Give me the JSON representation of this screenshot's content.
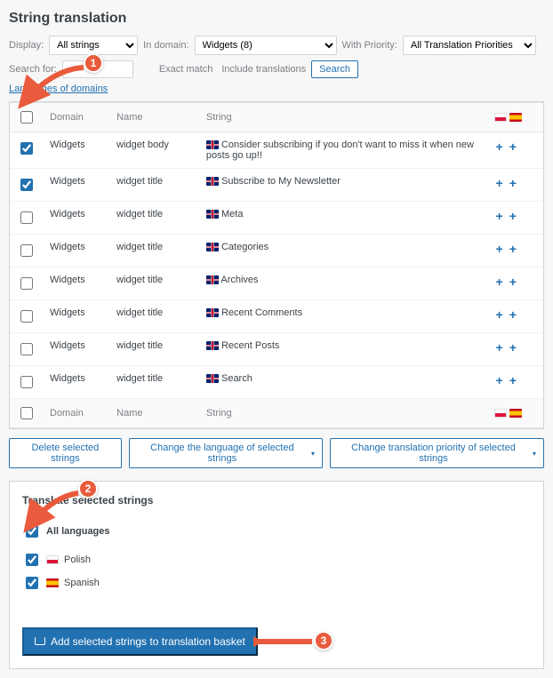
{
  "page_title": "String translation",
  "filters": {
    "display_label": "Display:",
    "display_options": [
      "All strings"
    ],
    "display_value": "All strings",
    "domain_label": "In domain:",
    "domain_options": [
      "Widgets (8)"
    ],
    "domain_value": "Widgets (8)",
    "priority_label": "With Priority:",
    "priority_options": [
      "All Translation Priorities"
    ],
    "priority_value": "All Translation Priorities",
    "search_label": "Search for:",
    "search_value": "",
    "exact_match_label": "Exact match",
    "include_translations_label": "Include translations",
    "search_button": "Search",
    "languages_link": "Languages of domains"
  },
  "table": {
    "headers": {
      "domain": "Domain",
      "name": "Name",
      "string": "String"
    },
    "header_flags": [
      "pl",
      "es"
    ],
    "rows": [
      {
        "checked": true,
        "domain": "Widgets",
        "name": "widget body",
        "flag": "gb",
        "string": "Consider subscribing if you don't want to miss it when new posts go up!!"
      },
      {
        "checked": true,
        "domain": "Widgets",
        "name": "widget title",
        "flag": "gb",
        "string": "Subscribe to My Newsletter"
      },
      {
        "checked": false,
        "domain": "Widgets",
        "name": "widget title",
        "flag": "gb",
        "string": "Meta"
      },
      {
        "checked": false,
        "domain": "Widgets",
        "name": "widget title",
        "flag": "gb",
        "string": "Categories"
      },
      {
        "checked": false,
        "domain": "Widgets",
        "name": "widget title",
        "flag": "gb",
        "string": "Archives"
      },
      {
        "checked": false,
        "domain": "Widgets",
        "name": "widget title",
        "flag": "gb",
        "string": "Recent Comments"
      },
      {
        "checked": false,
        "domain": "Widgets",
        "name": "widget title",
        "flag": "gb",
        "string": "Recent Posts"
      },
      {
        "checked": false,
        "domain": "Widgets",
        "name": "widget title",
        "flag": "gb",
        "string": "Search"
      }
    ]
  },
  "actions": {
    "delete": "Delete selected strings",
    "change_lang": "Change the language of selected strings",
    "change_priority": "Change translation priority of selected strings"
  },
  "translate": {
    "title": "Translate selected strings",
    "all_languages_label": "All languages",
    "languages": [
      {
        "label": "Polish",
        "flag": "pl"
      },
      {
        "label": "Spanish",
        "flag": "es"
      }
    ],
    "add_button": "Add selected strings to translation basket"
  },
  "callouts": {
    "c1": "1",
    "c2": "2",
    "c3": "3"
  }
}
